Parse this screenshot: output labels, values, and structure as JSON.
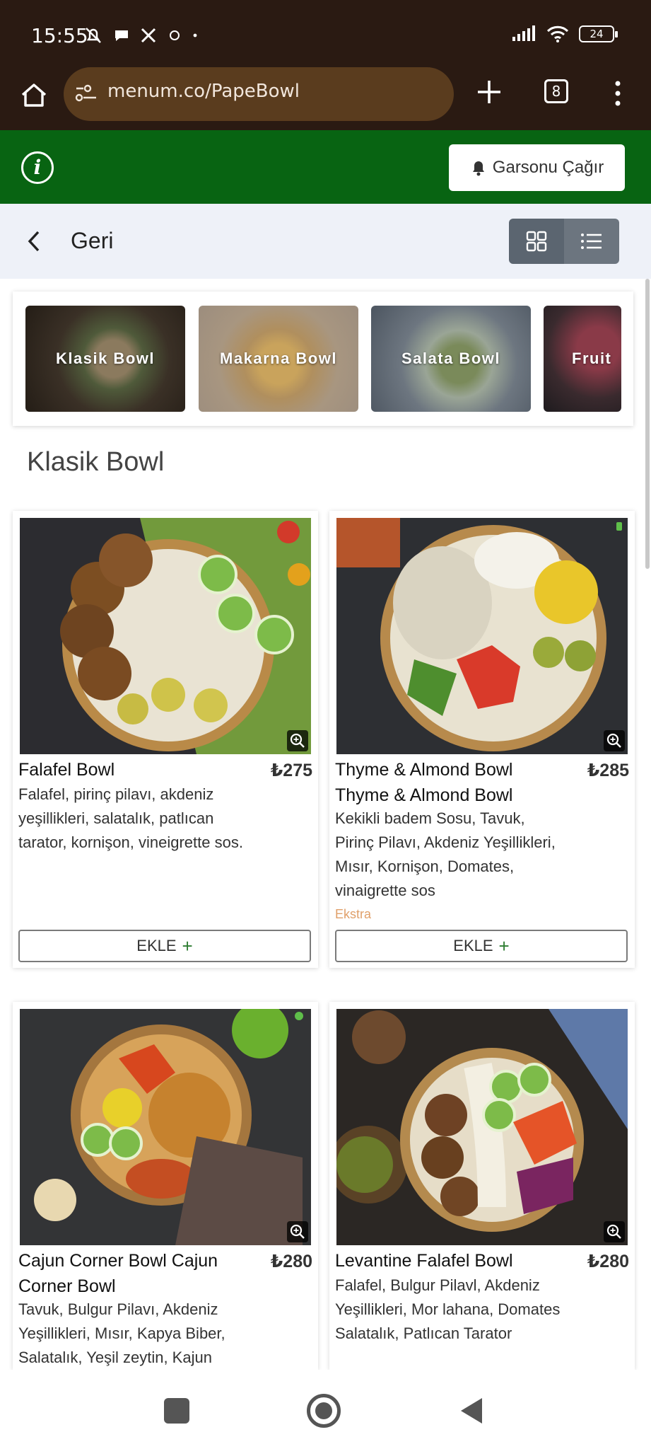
{
  "status_bar": {
    "time": "15:55",
    "battery": "24"
  },
  "browser": {
    "url": "menum.co/PapeBowl",
    "tab_count": "8"
  },
  "header": {
    "call_waiter_label": "Garsonu Çağır"
  },
  "nav": {
    "back_label": "Geri"
  },
  "categories": [
    {
      "label": "Klasik Bowl"
    },
    {
      "label": "Makarna Bowl"
    },
    {
      "label": "Salata Bowl"
    },
    {
      "label": "Fruit"
    }
  ],
  "section_title": "Klasik Bowl",
  "products": [
    {
      "name": "Falafel Bowl",
      "price": "₺275",
      "description": "Falafel, pirinç pilavı, akdeniz yeşillikleri, salatalık, patlıcan tarator, kornişon, vineigrette sos.",
      "add_label": "EKLE"
    },
    {
      "name": "Thyme & Almond Bowl Thyme & Almond Bowl",
      "price": "₺285",
      "description": "Kekikli badem Sosu, Tavuk, Pirinç Pilavı, Akdeniz Yeşillikleri, Mısır, Kornişon, Domates, vinaigrette sos",
      "extra": "Ekstra",
      "add_label": "EKLE"
    },
    {
      "name": "Cajun Corner Bowl Cajun Corner Bowl",
      "price": "₺280",
      "description": "Tavuk, Bulgur Pilavı, Akdeniz Yeşillikleri, Mısır, Kapya Biber, Salatalık, Yeşil zeytin, Kajun"
    },
    {
      "name": "Levantine Falafel Bowl",
      "price": "₺280",
      "description": "Falafel, Bulgur Pilavl, Akdeniz Yeşillikleri, Mor lahana, Domates Salatalık, Patlıcan Tarator"
    }
  ],
  "colors": {
    "brand_green": "#086412",
    "browser_brown": "#2a1a12",
    "extra_orange": "#e0a06a"
  }
}
